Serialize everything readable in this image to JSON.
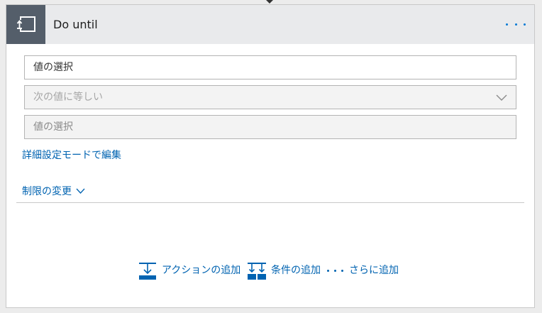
{
  "card": {
    "title": "Do until",
    "icon": "loop-icon",
    "more_icon": "more-options-icon"
  },
  "condition": {
    "left_value_placeholder": "値の選択",
    "operator_selected": "次の値に等しい",
    "right_value_placeholder": "値の選択"
  },
  "links": {
    "advanced_mode": "詳細設定モードで編集",
    "change_limits": "制限の変更"
  },
  "actions": {
    "add_action": "アクションの追加",
    "add_condition": "条件の追加",
    "more": "さらに追加"
  },
  "colors": {
    "accent": "#0063b1",
    "icon_bg": "#545e6a",
    "header_bg": "#e9eaec"
  }
}
